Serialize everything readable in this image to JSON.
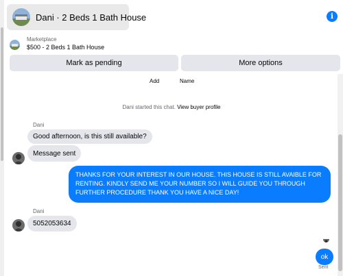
{
  "header": {
    "title": "Dani · 2 Beds 1 Bath House",
    "info_icon": "info-icon",
    "accent": "#0a7cff"
  },
  "listing": {
    "label": "Marketplace",
    "price_title": "$500 - 2 Beds 1 Bath House"
  },
  "actions": {
    "pending_label": "Mark as pending",
    "more_label": "More options"
  },
  "labels": {
    "add": "Add",
    "name": "Name"
  },
  "system": {
    "started": "Dani started this chat. ",
    "view_profile": "View buyer profile"
  },
  "messages": {
    "sender1": "Dani",
    "msg1": "Good afternoon, is this still available?",
    "msg2": "Message sent",
    "out1": "THANKS FOR YOUR INTEREST IN OUR HOUSE. THIS HOUSE IS STILL AVAIBLE FOR RENTING. KINDLY SEND ME YOUR NUMBER SO I WILL GUIDE YOU THROUGH FURTHER PROCEDURE THANK YOU HAVE A NICE DAY!",
    "sender2": "Dani",
    "msg3": "5052053634",
    "out2": "ok",
    "status": "Sent"
  }
}
